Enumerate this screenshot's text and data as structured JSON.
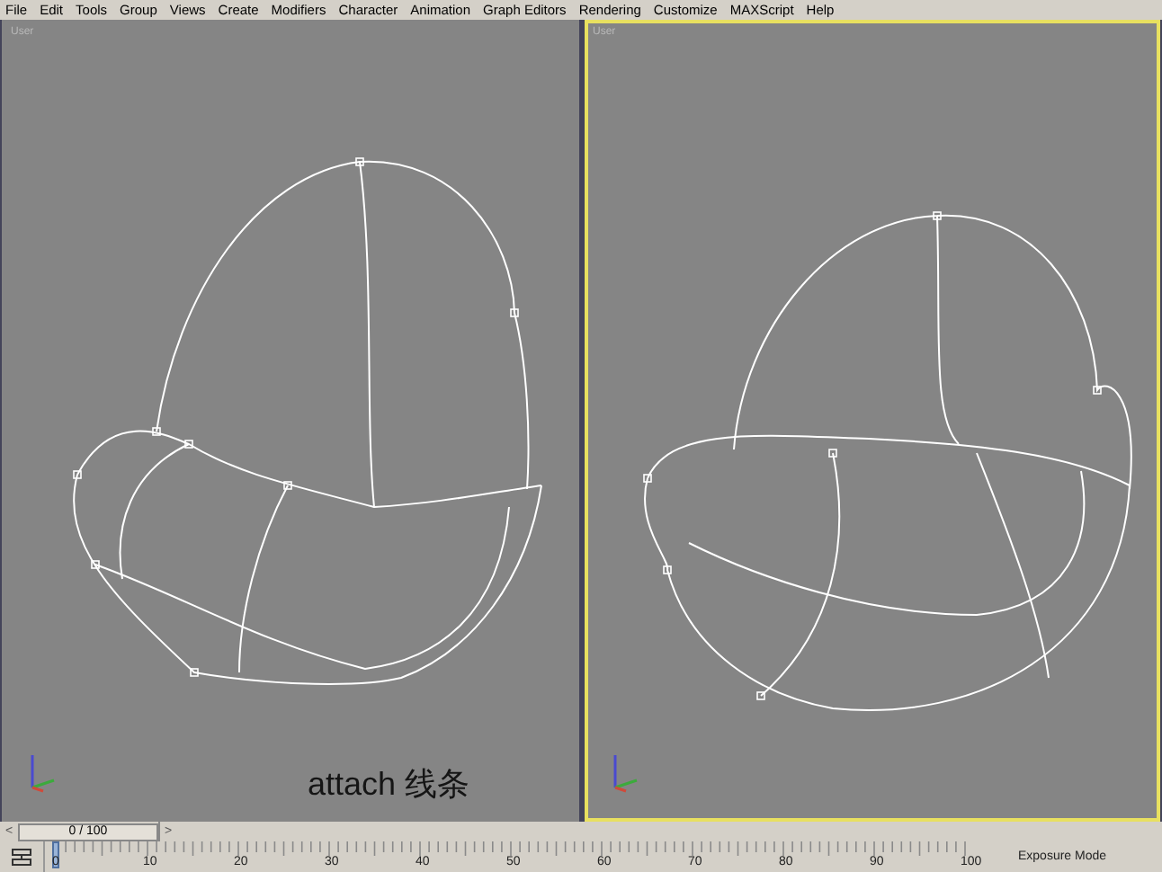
{
  "menu_bar": {
    "items": [
      "File",
      "Edit",
      "Tools",
      "Group",
      "Views",
      "Create",
      "Modifiers",
      "Character",
      "Animation",
      "Graph Editors",
      "Rendering",
      "Customize",
      "MAXScript",
      "Help"
    ]
  },
  "viewports": [
    {
      "label": "User",
      "selected": false,
      "annotation": "attach 线条"
    },
    {
      "label": "User",
      "selected": true
    }
  ],
  "time_slider": {
    "prev": "<",
    "position": "0 / 100",
    "next": ">"
  },
  "timeline": {
    "labels": [
      "0",
      "10",
      "20",
      "30",
      "40",
      "50",
      "60",
      "70",
      "80",
      "90",
      "100"
    ]
  },
  "status_bar": {
    "text": "Exposure Mode"
  }
}
